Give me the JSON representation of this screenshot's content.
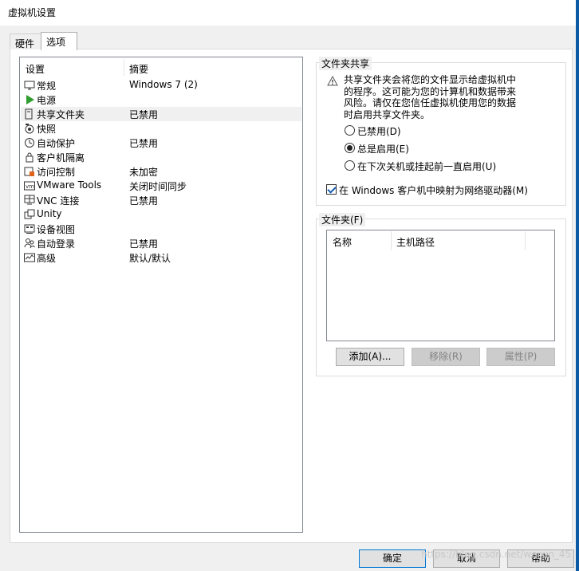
{
  "window": {
    "title": "虚拟机设置"
  },
  "tabs": [
    {
      "label": "硬件"
    },
    {
      "label": "选项"
    }
  ],
  "list": {
    "header_settings": "设置",
    "header_summary": "摘要",
    "items": [
      {
        "label": "常规",
        "summary": "Windows 7 (2)",
        "icon": "monitor-icon"
      },
      {
        "label": "电源",
        "summary": "",
        "icon": "play-icon"
      },
      {
        "label": "共享文件夹",
        "summary": "已禁用",
        "icon": "shared-folder-icon"
      },
      {
        "label": "快照",
        "summary": "",
        "icon": "snapshot-icon"
      },
      {
        "label": "自动保护",
        "summary": "已禁用",
        "icon": "clock-icon"
      },
      {
        "label": "客户机隔离",
        "summary": "",
        "icon": "lock-icon"
      },
      {
        "label": "访问控制",
        "summary": "未加密",
        "icon": "access-control-icon"
      },
      {
        "label": "VMware Tools",
        "summary": "关闭时间同步",
        "icon": "vmware-tools-icon"
      },
      {
        "label": "VNC 连接",
        "summary": "已禁用",
        "icon": "vnc-icon"
      },
      {
        "label": "Unity",
        "summary": "",
        "icon": "unity-icon"
      },
      {
        "label": "设备视图",
        "summary": "",
        "icon": "device-view-icon"
      },
      {
        "label": "自动登录",
        "summary": "已禁用",
        "icon": "users-icon"
      },
      {
        "label": "高级",
        "summary": "默认/默认",
        "icon": "graph-icon"
      }
    ]
  },
  "sharing": {
    "group_title": "文件夹共享",
    "warning_lines": [
      "共享文件夹会将您的文件显示给虚拟机中",
      "的程序。这可能为您的计算机和数据带来",
      "风险。请仅在您信任虚拟机使用您的数据",
      "时启用共享文件夹。"
    ],
    "options": [
      {
        "label": "已禁用(D)",
        "selected": false
      },
      {
        "label": "总是启用(E)",
        "selected": true
      },
      {
        "label": "在下次关机或挂起前一直启用(U)",
        "selected": false
      }
    ],
    "map_drive": {
      "label": "在 Windows 客户机中映射为网络驱动器(M)",
      "checked": true
    }
  },
  "folders": {
    "group_title": "文件夹(F)",
    "col_name": "名称",
    "col_path": "主机路径",
    "add_label": "添加(A)...",
    "remove_label": "移除(R)",
    "properties_label": "属性(P)"
  },
  "footer": {
    "ok_label": "确定",
    "cancel_label": "取消",
    "help_label": "帮助",
    "watermark": "https://blog.csdn.net/weixin_45"
  },
  "colors": {
    "accent": "#0078d7",
    "selection": "#f0f0f0",
    "play_green": "#2e9e2e",
    "window_edge": "#0a5aa6"
  }
}
